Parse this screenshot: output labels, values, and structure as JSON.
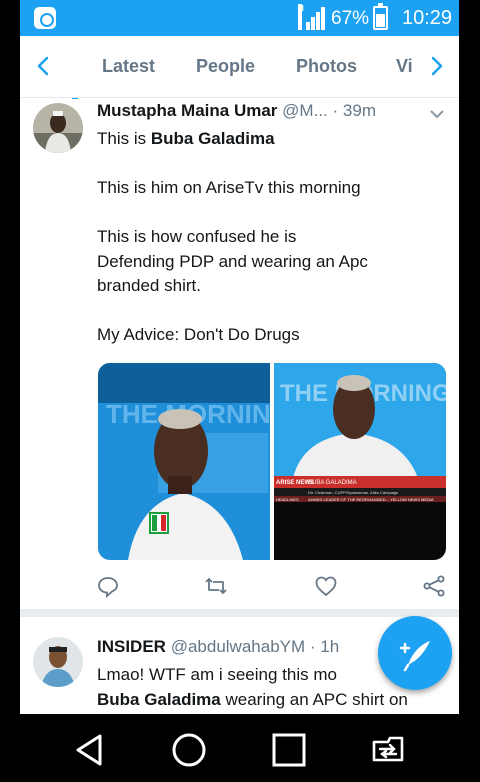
{
  "status_bar": {
    "network_badge": "H",
    "battery_percent": "67%",
    "time": "10:29"
  },
  "tabs": [
    {
      "label": "Latest",
      "active": true
    },
    {
      "label": "People",
      "active": false
    },
    {
      "label": "Photos",
      "active": false
    },
    {
      "label": "Vi",
      "active": false
    }
  ],
  "tweets": [
    {
      "name": "Mustapha Maina Umar",
      "handle": "@M...",
      "separator": "·",
      "time": "39m",
      "lines": [
        {
          "pre": "This is ",
          "bold": "Buba Galadima",
          "post": ""
        },
        {
          "text": "This is him on AriseTv this morning"
        },
        {
          "text": "This is how confused he is"
        },
        {
          "text": "Defending PDP and wearing an Apc"
        },
        {
          "text": "branded shirt."
        },
        {
          "text": "My Advice: Don't Do Drugs"
        }
      ],
      "media": {
        "left_watermark": "THE MORNING SHOW",
        "right_watermark": "THE MORNING SHOW",
        "lower_third_brand": "ARISE NEWS",
        "lower_third_name": "BUBA GALADIMA",
        "lower_third_role": "Dir. Chairman, CUPP/Spokesman, Atiku Campaign",
        "lower_third_ticker": "AHMED LEADER OF THE REORGANIZED... YELLOW NEWS MEDIA",
        "lower_third_tag": "HEADLINES"
      }
    },
    {
      "name": "INSIDER",
      "handle": "@abdulwahabYM",
      "separator": "·",
      "time": "1h",
      "lines": [
        {
          "text": "Lmao! WTF am i seeing this mo"
        },
        {
          "pre": "",
          "bold": "Buba Galadima",
          "post": " wearing an APC shirt on"
        }
      ]
    }
  ],
  "actions": [
    "reply-icon",
    "retweet-icon",
    "like-icon",
    "share-icon"
  ],
  "fab": {
    "icon": "compose-tweet-icon",
    "color": "#1da1f2"
  },
  "nav": [
    "back-icon",
    "home-icon",
    "recents-icon",
    "screen-switch-icon"
  ],
  "colors": {
    "twitter_blue": "#1da1f2",
    "text": "#14171a",
    "secondary": "#657786"
  }
}
